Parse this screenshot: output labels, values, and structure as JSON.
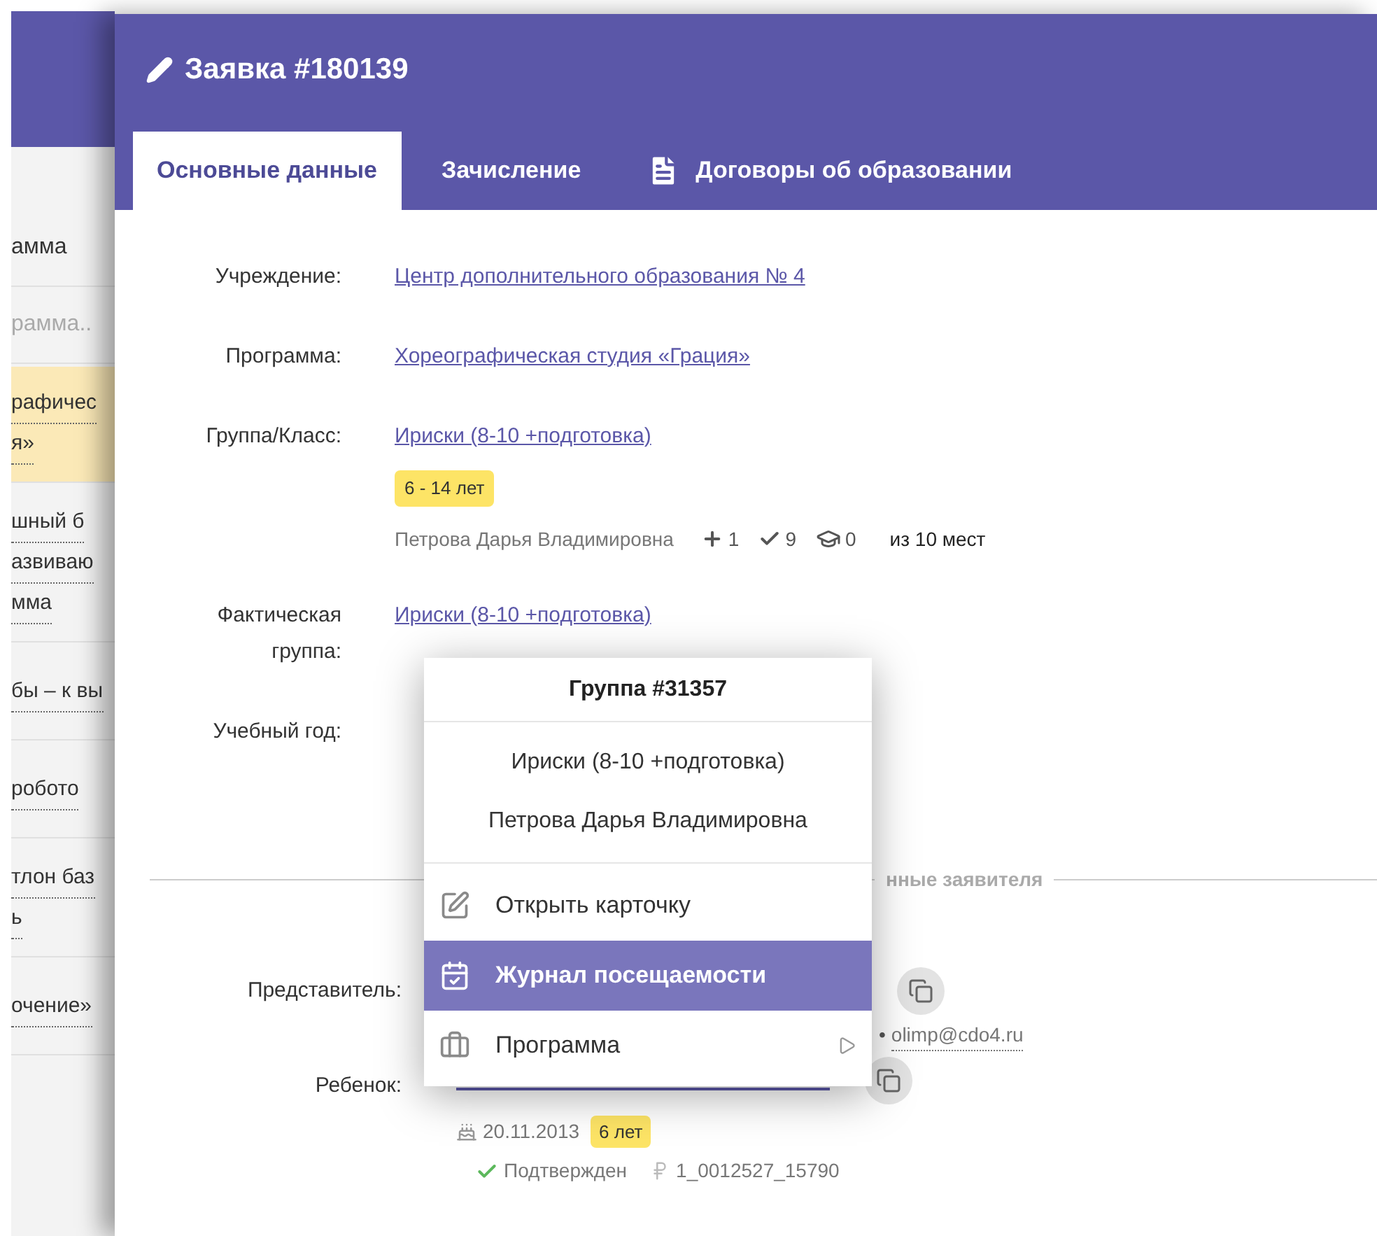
{
  "background_page": {
    "column_header": "амма",
    "filter_placeholder": "рамма..",
    "rows": [
      {
        "lines": [
          "рафичес",
          "я»"
        ],
        "selected": true
      },
      {
        "lines": [
          "шный б",
          "азвиваю",
          "мма"
        ],
        "selected": false
      },
      {
        "lines": [
          "бы – к вы"
        ],
        "selected": false
      },
      {
        "lines": [
          "робото"
        ],
        "selected": false
      },
      {
        "lines": [
          "тлон баз",
          "ь"
        ],
        "selected": false
      },
      {
        "lines": [
          "очение»"
        ],
        "selected": false
      }
    ]
  },
  "modal": {
    "title": "Заявка #180139",
    "tabs": [
      {
        "label": "Основные данные",
        "selected": true,
        "kind": "plain"
      },
      {
        "label": "Зачисление",
        "selected": false,
        "kind": "plain"
      },
      {
        "label": "Договоры об образовании",
        "selected": false,
        "kind": "document"
      }
    ],
    "fields": [
      {
        "label": "Учреждение:",
        "link": "Центр дополнительного образования № 4"
      },
      {
        "label": "Программа:",
        "link": "Хореографическая студия «Грация»"
      },
      {
        "label": "Группа/Класс:",
        "link": "Ириски (8-10 +подготовка)",
        "age_badge": "6 - 14 лет",
        "teacher": "Петрова Дарья Владимировна",
        "stats": [
          {
            "kind": "plus",
            "value": "1"
          },
          {
            "kind": "check",
            "value": "9"
          },
          {
            "kind": "graduate",
            "value": "0"
          }
        ],
        "capacity": "из 10 мест"
      },
      {
        "label": "Фактическая группа:",
        "link": "Ириски (8-10 +подготовка)"
      },
      {
        "label": "Учебный год:"
      }
    ],
    "section_title": "нные заявителя",
    "applicant": {
      "label": "Представитель:",
      "separator": "•",
      "email": "olimp@cdo4.ru"
    },
    "child": {
      "label": "Ребенок:",
      "birth_date": "20.11.2013",
      "age_badge": "6 лет",
      "status": "Подтвержден",
      "account": "1_0012527_15790"
    }
  },
  "popup": {
    "title": "Группа #31357",
    "lines": [
      "Ириски (8-10 +подготовка)",
      "Петрова Дарья Владимировна"
    ],
    "items": [
      {
        "label": "Открыть карточку",
        "kind": "edit",
        "selected": false,
        "submenu": false
      },
      {
        "label": "Журнал посещаемости",
        "kind": "calendar",
        "selected": true,
        "submenu": false
      },
      {
        "label": "Программа",
        "kind": "briefcase",
        "selected": false,
        "submenu": true
      }
    ]
  }
}
